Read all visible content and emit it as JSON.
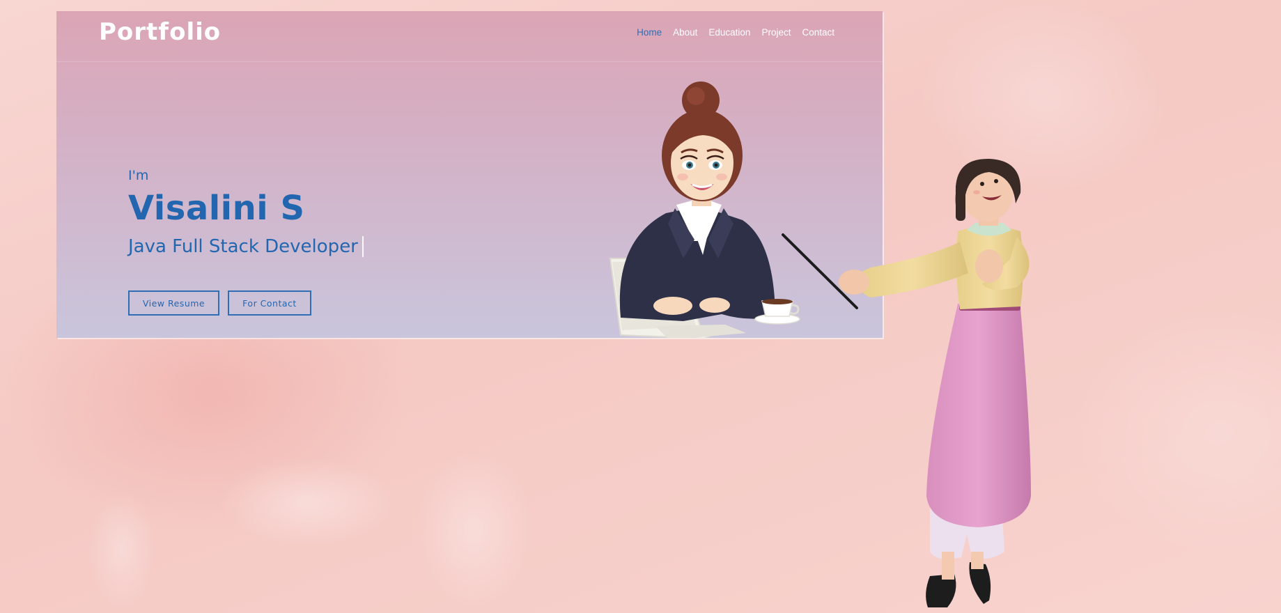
{
  "site": {
    "logo": "Portfolio",
    "nav": [
      {
        "label": "Home",
        "active": true
      },
      {
        "label": "About",
        "active": false
      },
      {
        "label": "Education",
        "active": false
      },
      {
        "label": "Project",
        "active": false
      },
      {
        "label": "Contact",
        "active": false
      }
    ],
    "hero": {
      "greeting": "I'm",
      "name": "Visalini S",
      "role": "Java Full Stack Developer"
    },
    "buttons": {
      "resume": "View Resume",
      "contact": "For Contact"
    }
  },
  "colors": {
    "accent": "#2366b0",
    "nav_active": "#2f6db5",
    "header_top": "#dba5b5",
    "header_bottom": "#c9c5dc",
    "background": "#f5c9c4"
  },
  "illustrations": {
    "office": "woman-at-laptop-illustration",
    "presenter": "3d-teacher-with-pointer-illustration"
  }
}
